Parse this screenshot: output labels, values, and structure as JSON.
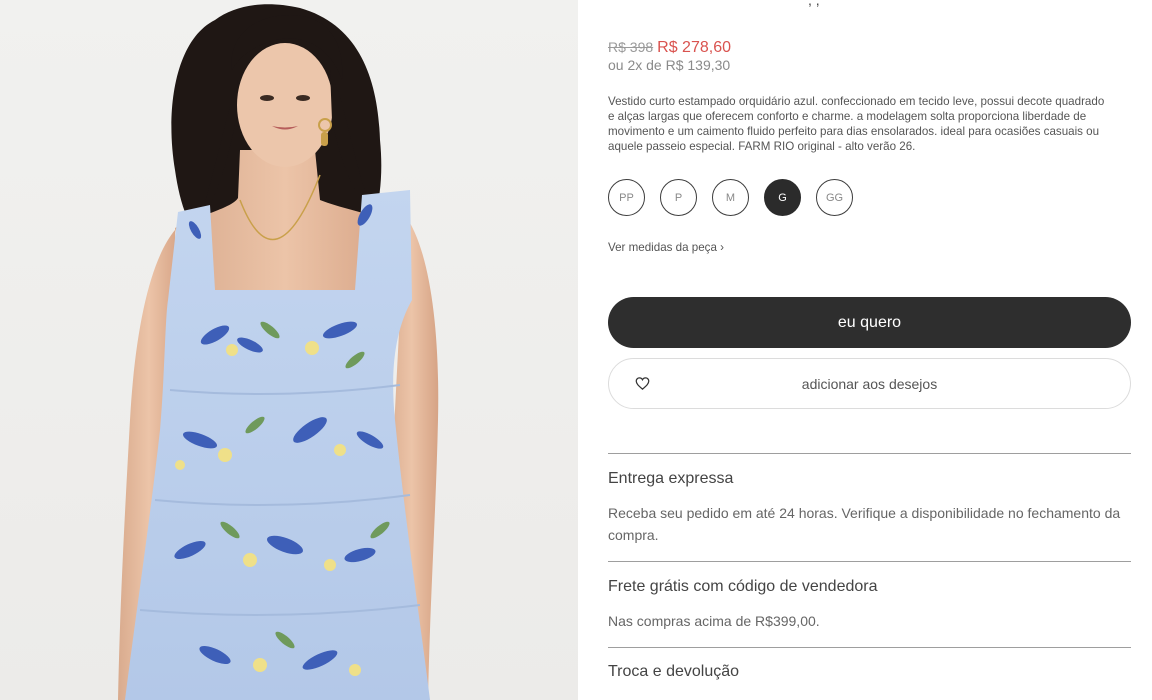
{
  "header": {
    "title_fragment": ", ,"
  },
  "price": {
    "old": "R$ 398",
    "current": "R$ 278,60",
    "installments": "ou 2x de R$ 139,30"
  },
  "description": "Vestido curto estampado orquidário azul. confeccionado em tecido leve, possui decote quadrado e alças largas que oferecem conforto e charme. a modelagem solta proporciona liberdade de movimento e um caimento fluido perfeito para dias ensolarados. ideal para ocasiões casuais ou aquele passeio especial. FARM RIO original - alto verão 26.",
  "sizes": [
    {
      "label": "PP",
      "selected": false
    },
    {
      "label": "P",
      "selected": false
    },
    {
      "label": "M",
      "selected": false
    },
    {
      "label": "G",
      "selected": true
    },
    {
      "label": "GG",
      "selected": false
    }
  ],
  "measures_link": "Ver medidas da peça ›",
  "buttons": {
    "buy": "eu quero",
    "wishlist": "adicionar aos desejos",
    "wishlist_icon": "heart-icon"
  },
  "sections": [
    {
      "title": "Entrega expressa",
      "text": "Receba seu pedido em até 24 horas. Verifique a disponibilidade no fechamento da compra."
    },
    {
      "title": "Frete grátis com código de vendedora",
      "text": "Nas compras acima de R$399,00."
    },
    {
      "title": "Troca e devolução",
      "text": ""
    }
  ],
  "colors": {
    "sale_price": "#d9534f",
    "button_dark": "#2e2e2e",
    "dress_blue": "#b9cdea"
  }
}
